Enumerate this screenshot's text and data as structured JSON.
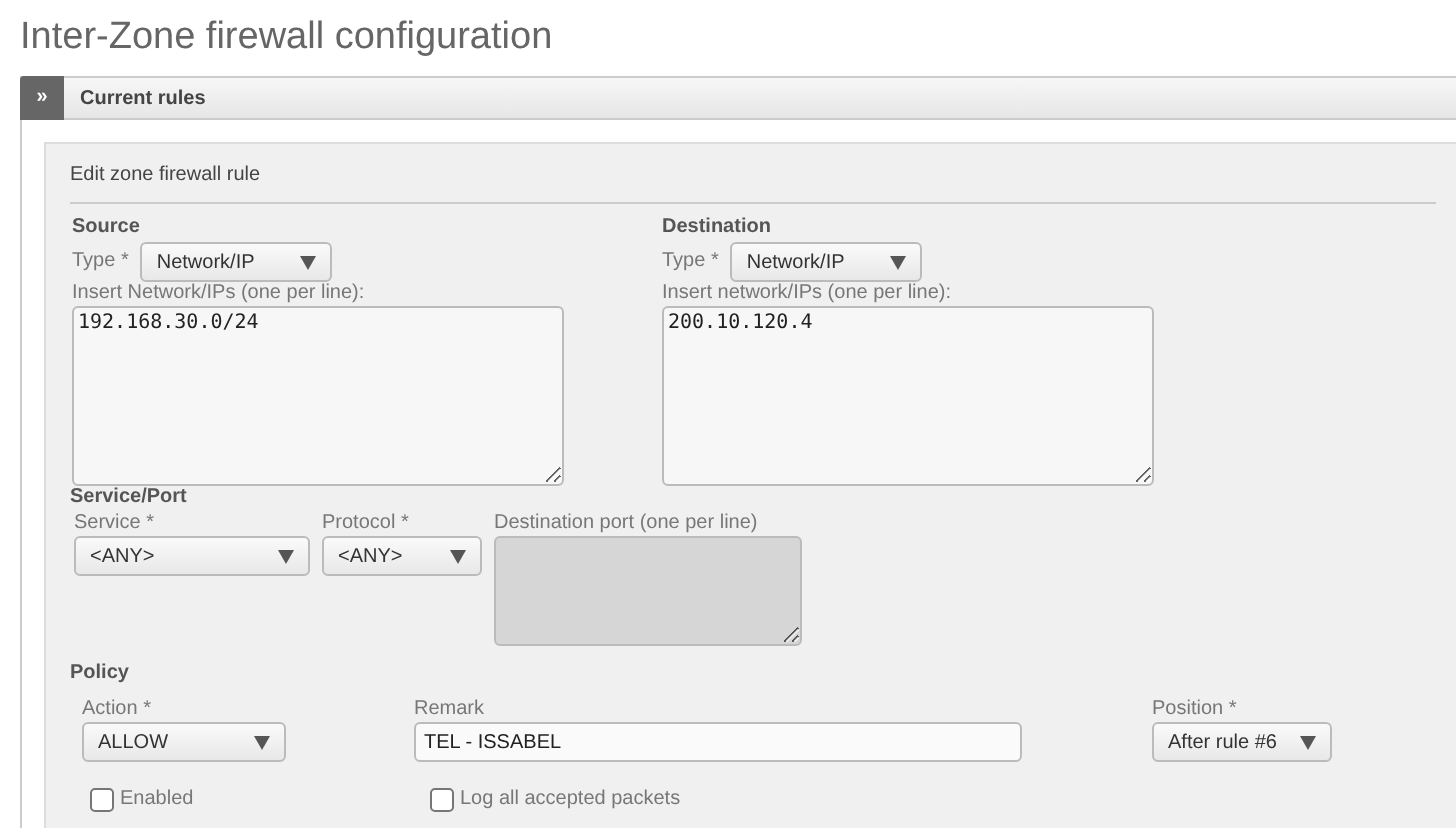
{
  "page_title": "Inter-Zone firewall configuration",
  "panel": {
    "toggle": "»",
    "title": "Current rules"
  },
  "form": {
    "title": "Edit zone firewall rule",
    "source": {
      "heading": "Source",
      "type_label": "Type *",
      "type_value": "Network/IP",
      "list_label": "Insert Network/IPs (one per line):",
      "list_value": "192.168.30.0/24"
    },
    "destination": {
      "heading": "Destination",
      "type_label": "Type *",
      "type_value": "Network/IP",
      "list_label": "Insert network/IPs (one per line):",
      "list_value": "200.10.120.4"
    },
    "service": {
      "heading": "Service/Port",
      "service_label": "Service *",
      "service_value": "<ANY>",
      "protocol_label": "Protocol *",
      "protocol_value": "<ANY>",
      "port_label": "Destination port (one per line)",
      "port_disabled": true
    },
    "policy": {
      "heading": "Policy",
      "action_label": "Action *",
      "action_value": "ALLOW",
      "remark_label": "Remark",
      "remark_value": "TEL - ISSABEL",
      "position_label": "Position *",
      "position_value": "After rule #6"
    },
    "checkboxes": [
      {
        "label": "Enabled",
        "checked": false
      },
      {
        "label": "Log all accepted packets",
        "checked": false
      }
    ]
  }
}
